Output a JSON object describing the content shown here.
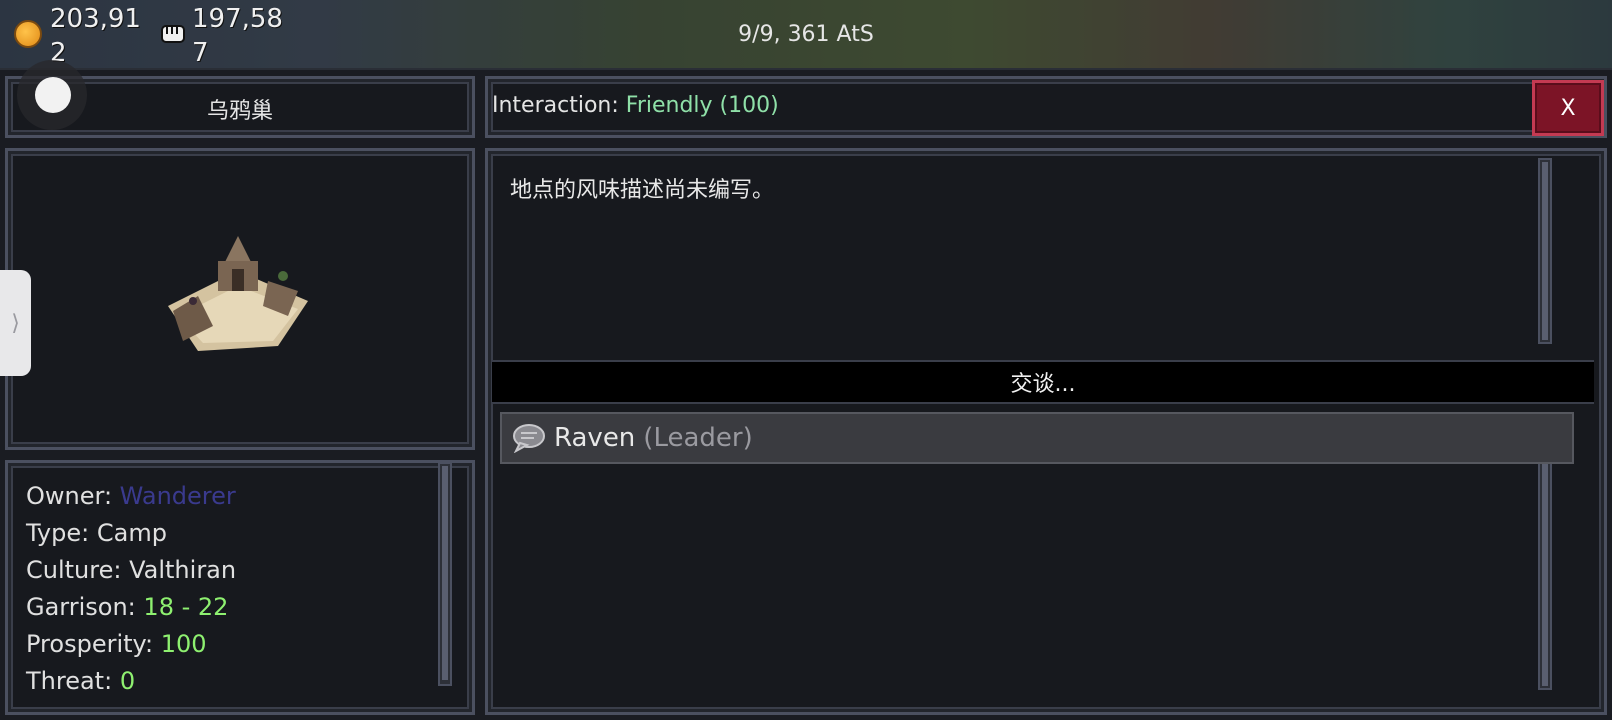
{
  "resources": {
    "gold": "203,912",
    "manpower": "197,587"
  },
  "date": "9/9, 361 AtS",
  "location": {
    "name": "乌鸦巢",
    "description": "地点的风味描述尚未编写。"
  },
  "interaction": {
    "label": "Interaction:",
    "value": "Friendly (100)",
    "value_color": "#8fe0a8"
  },
  "close_label": "X",
  "info": {
    "owner_label": "Owner:",
    "owner_value": "Wanderer",
    "type_label": "Type:",
    "type_value": "Camp",
    "culture_label": "Culture:",
    "culture_value": "Valthiran",
    "garrison_label": "Garrison:",
    "garrison_value": "18 - 22",
    "prosperity_label": "Prosperity:",
    "prosperity_value": "100",
    "threat_label": "Threat:",
    "threat_value": "0"
  },
  "talk": {
    "header": "交谈...",
    "npcs": [
      {
        "name": "Raven",
        "role": "(Leader)",
        "icon": "speech-bubble-icon"
      }
    ]
  },
  "sidetab_glyph": "⟩"
}
